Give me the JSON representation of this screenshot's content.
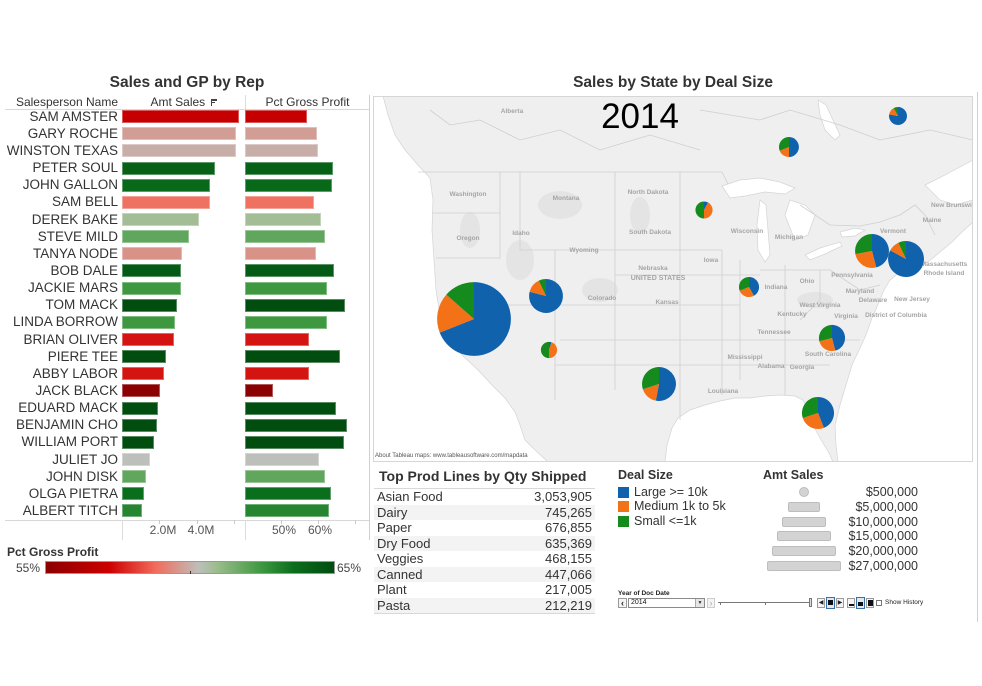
{
  "chart_data": [
    {
      "type": "bar",
      "title": "Sales and GP by Rep",
      "column_headers": {
        "name": "Salesperson Name",
        "amt": "Amt Sales",
        "pct": "Pct Gross Profit"
      },
      "sort": "Amt Sales descending",
      "color_by": "Pct Gross Profit",
      "categories": [
        "SAM AMSTER",
        "GARY ROCHE",
        "WINSTON TEXAS",
        "PETER SOUL",
        "JOHN GALLON",
        "SAM BELL",
        "DEREK BAKE",
        "STEVE MILD",
        "TANYA NODE",
        "BOB DALE",
        "JACKIE MARS",
        "TOM MACK",
        "LINDA BORROW",
        "BRIAN OLIVER",
        "PIERE TEE",
        "ABBY LABOR",
        "JACK BLACK",
        "EDUARD MACK",
        "BENJAMIN CHO",
        "WILLIAM PORT",
        "JULIET JO",
        "JOHN DISK",
        "OLGA PIETRA",
        "ALBERT TITCH"
      ],
      "series": [
        {
          "name": "Amt Sales",
          "unit": "USD",
          "values": [
            6270000,
            6110000,
            6110000,
            4990000,
            4720000,
            4720000,
            4130000,
            3590000,
            3220000,
            3160000,
            3140000,
            2950000,
            2840000,
            2790000,
            2360000,
            2250000,
            2040000,
            1930000,
            1880000,
            1720000,
            1500000,
            1290000,
            1180000,
            1070000
          ]
        },
        {
          "name": "Pct Gross Profit",
          "unit": "%",
          "values": [
            57.0,
            59.7,
            60.0,
            64.1,
            63.8,
            58.9,
            60.8,
            61.9,
            59.5,
            64.4,
            62.5,
            67.4,
            62.5,
            57.5,
            66.0,
            57.5,
            47.7,
            64.9,
            67.9,
            67.1,
            60.3,
            61.9,
            63.6,
            63.0
          ]
        }
      ],
      "axes": {
        "amt": {
          "range": [
            0,
            6500000
          ],
          "ticks": [
            2000000,
            4000000
          ],
          "tick_labels": [
            "2.0M",
            "4.0M"
          ]
        },
        "pct": {
          "range": [
            40,
            70
          ],
          "ticks": [
            50,
            60
          ],
          "tick_labels": [
            "50%",
            "60%"
          ]
        }
      },
      "grid": false
    },
    {
      "type": "pie",
      "title": "Sales by State by Deal Size",
      "subtitle": "2014",
      "attribution": "About Tableau maps: www.tableausoftware.com/mapdata",
      "slice_categories": [
        "Large >= 10k",
        "Medium 1k to 5k",
        "Small <=1k"
      ],
      "size_measure": "Amt Sales",
      "series": [
        {
          "region": "California",
          "amt_sales": 27000000,
          "shares": [
            0.69,
            0.175,
            0.135
          ]
        },
        {
          "region": "Utah",
          "amt_sales": 5700000,
          "shares": [
            0.79,
            0.14,
            0.07
          ]
        },
        {
          "region": "Arizona",
          "amt_sales": 1300000,
          "shares": [
            0.05,
            0.45,
            0.5
          ]
        },
        {
          "region": "Quebec",
          "amt_sales": 1600000,
          "shares": [
            0.78,
            0.14,
            0.08
          ]
        },
        {
          "region": "Ontario",
          "amt_sales": 2000000,
          "shares": [
            0.5,
            0.19,
            0.31
          ]
        },
        {
          "region": "Minnesota",
          "amt_sales": 1450000,
          "shares": [
            0.08,
            0.42,
            0.5
          ]
        },
        {
          "region": "Illinois",
          "amt_sales": 2000000,
          "shares": [
            0.42,
            0.27,
            0.31
          ]
        },
        {
          "region": "New York",
          "amt_sales": 5700000,
          "shares": [
            0.46,
            0.26,
            0.28
          ]
        },
        {
          "region": "Massachusetts",
          "amt_sales": 6400000,
          "shares": [
            0.83,
            0.1,
            0.07
          ]
        },
        {
          "region": "North Carolina",
          "amt_sales": 3400000,
          "shares": [
            0.46,
            0.25,
            0.29
          ]
        },
        {
          "region": "Texas",
          "amt_sales": 5700000,
          "shares": [
            0.53,
            0.17,
            0.3
          ]
        },
        {
          "region": "Florida",
          "amt_sales": 5100000,
          "shares": [
            0.44,
            0.26,
            0.3
          ]
        }
      ],
      "legend": "bottom"
    },
    {
      "type": "table",
      "title": "Top Prod Lines by Qty Shipped",
      "rows": [
        {
          "label": "Asian Food",
          "value": "3,053,905"
        },
        {
          "label": "Dairy",
          "value": "745,265"
        },
        {
          "label": "Paper",
          "value": "676,855"
        },
        {
          "label": "Dry Food",
          "value": "635,369"
        },
        {
          "label": "Veggies",
          "value": "468,155"
        },
        {
          "label": "Canned",
          "value": "447,066"
        },
        {
          "label": "Plant",
          "value": "217,005"
        },
        {
          "label": "Pasta",
          "value": "212,219"
        }
      ]
    }
  ],
  "pct_legend": {
    "title": "Pct Gross Profit",
    "min_label": "55%",
    "max_label": "65%",
    "min": 55,
    "max": 65,
    "stops": [
      {
        "value": 55,
        "color": "#8b0000"
      },
      {
        "value": 57.2,
        "color": "#cc0000"
      },
      {
        "value": 58.8,
        "color": "#f26b5b"
      },
      {
        "value": 60.3,
        "color": "#bdbfbb"
      },
      {
        "value": 60.9,
        "color": "#9ebd8e"
      },
      {
        "value": 62.5,
        "color": "#3d9840"
      },
      {
        "value": 63.6,
        "color": "#0b6e1d"
      },
      {
        "value": 65,
        "color": "#004d0f"
      }
    ]
  },
  "deal_size_legend": {
    "title": "Deal Size",
    "items": [
      {
        "label": "Large >= 10k",
        "color": "#1062ac"
      },
      {
        "label": "Medium 1k to 5k",
        "color": "#f47217"
      },
      {
        "label": "Small <=1k",
        "color": "#148b1c"
      }
    ]
  },
  "amt_sales_legend": {
    "title": "Amt Sales",
    "items": [
      {
        "label": "$500,000",
        "value": 500000
      },
      {
        "label": "$5,000,000",
        "value": 5000000
      },
      {
        "label": "$10,000,000",
        "value": 10000000
      },
      {
        "label": "$15,000,000",
        "value": 15000000
      },
      {
        "label": "$20,000,000",
        "value": 20000000
      },
      {
        "label": "$27,000,000",
        "value": 27000000
      }
    ]
  },
  "year_filter": {
    "title": "Year of Doc Date",
    "selected": "2014",
    "prev_icon": "‹",
    "next_icon": "›",
    "show_history_label": "Show History",
    "show_history_checked": false
  },
  "map_labels": [
    "Alberta",
    "Washington",
    "Montana",
    "North Dakota",
    "Oregon",
    "Idaho",
    "Wyoming",
    "South Dakota",
    "Nebraska",
    "UNITED STATES",
    "Colorado",
    "Kansas",
    "Iowa",
    "Wisconsin",
    "Michigan",
    "Vermont",
    "Maine",
    "New Brunswick",
    "Indiana",
    "Ohio",
    "Pennsylvania",
    "Massachusetts",
    "Rhode Island",
    "Maryland",
    "Delaware",
    "New Jersey",
    "West Virginia",
    "Virginia",
    "District of Columbia",
    "Kentucky",
    "Tennessee",
    "South Carolina",
    "Mississippi",
    "Alabama",
    "Georgia",
    "Louisiana"
  ]
}
